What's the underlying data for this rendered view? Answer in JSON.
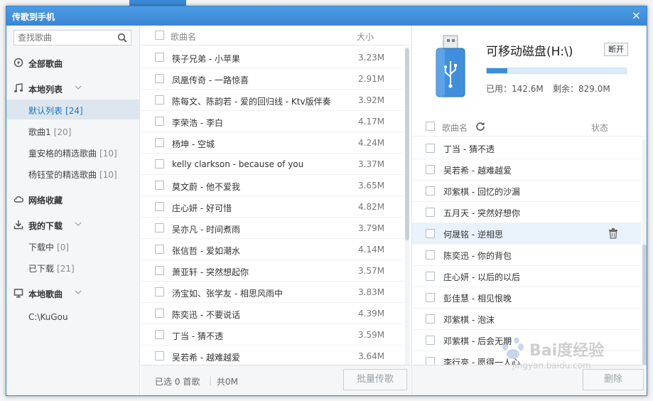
{
  "dialog": {
    "title": "传歌到手机",
    "close": "×"
  },
  "sidebar": {
    "search_placeholder": "查找歌曲",
    "all_songs": "全部歌曲",
    "local_list": "本地列表",
    "local_items": [
      {
        "label": "默认列表",
        "count": "[24]"
      },
      {
        "label": "歌曲1",
        "count": "[20]"
      },
      {
        "label": "童安格的精选歌曲",
        "count": "[10]"
      },
      {
        "label": "杨钰莹的精选歌曲",
        "count": "[10]"
      }
    ],
    "net_fav": "网络收藏",
    "my_downloads": "我的下载",
    "download_items": [
      {
        "label": "下载中",
        "count": "[0]"
      },
      {
        "label": "已下载",
        "count": "[21]"
      }
    ],
    "local_songs": "本地歌曲",
    "local_path": "C:\\KuGou"
  },
  "songlist": {
    "col_name": "歌曲名",
    "col_size": "大小",
    "rows": [
      {
        "name": "筷子兄弟 - 小苹果",
        "size": "3.23M"
      },
      {
        "name": "凤凰传奇 - 一路惊喜",
        "size": "2.91M"
      },
      {
        "name": "陈每文、陈韵若 - 爱的回归线 - Ktv版伴奏",
        "size": "3.92M"
      },
      {
        "name": "李荣浩 - 李白",
        "size": "4.17M"
      },
      {
        "name": "杨坤 - 空城",
        "size": "4.24M"
      },
      {
        "name": "kelly clarkson - because of you",
        "size": "3.37M"
      },
      {
        "name": "莫文蔚 - 他不爱我",
        "size": "3.65M"
      },
      {
        "name": "庄心妍 - 好可惜",
        "size": "4.82M"
      },
      {
        "name": "吴亦凡 - 时间煮雨",
        "size": "3.79M"
      },
      {
        "name": "张信哲 - 爱如潮水",
        "size": "4.14M"
      },
      {
        "name": "萧亚轩 - 突然想起你",
        "size": "3.57M"
      },
      {
        "name": "汤宝如、张学友 - 相思风雨中",
        "size": "3.83M"
      },
      {
        "name": "陈奕迅 - 不要说话",
        "size": "4.39M"
      },
      {
        "name": "丁当 - 猜不透",
        "size": "3.59M"
      },
      {
        "name": "吴若希 - 越难越爱",
        "size": "3.64M"
      }
    ],
    "selected_prefix": "已选",
    "selected_count": "0",
    "selected_suffix": "首歌",
    "total_label": "共0M",
    "transfer_button": "批量传歌"
  },
  "device": {
    "name": "可移动磁盘(H:\\)",
    "eject": "断开",
    "used": "已用：142.6M",
    "free": "剩余：829.0M",
    "usage_fraction": 0.147,
    "col_name": "歌曲名",
    "col_status": "状态",
    "songs": [
      "丁当 - 猜不透",
      "吴若希 - 越难越爱",
      "邓紫棋 - 回忆的沙漏",
      "五月天 - 突然好想你",
      "何晟铭 - 逆相思",
      "陈奕迅 - 你的背包",
      "庄心妍 - 以后的以后",
      "彭佳慧 - 相见恨晚",
      "邓紫棋 - 泡沫",
      "邓紫棋 - 后会无期",
      "李行亮 - 愿得一人心"
    ],
    "delete_button": "删除"
  },
  "watermark": {
    "text": "Bai度经验",
    "sub": "jingyan.baidu.com"
  },
  "colors": {
    "accent": "#3a86d3",
    "active_bg": "#dde6ee",
    "highlight_row": "#e9f2fb"
  }
}
